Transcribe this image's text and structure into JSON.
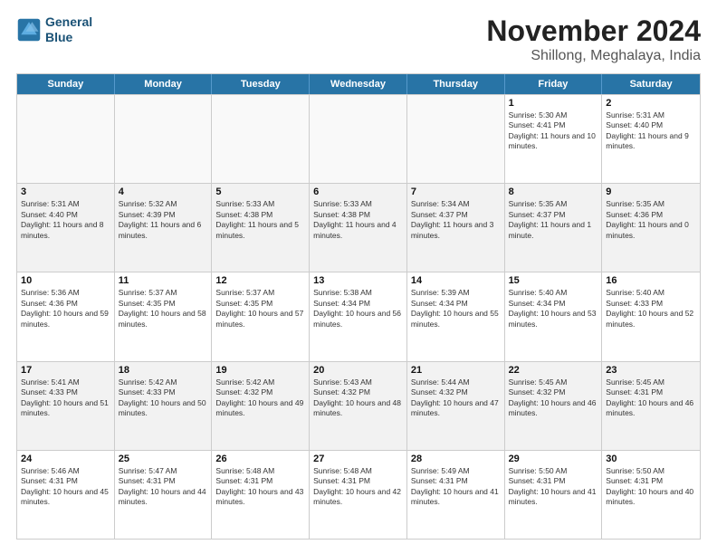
{
  "logo": {
    "line1": "General",
    "line2": "Blue"
  },
  "title": "November 2024",
  "subtitle": "Shillong, Meghalaya, India",
  "days_of_week": [
    "Sunday",
    "Monday",
    "Tuesday",
    "Wednesday",
    "Thursday",
    "Friday",
    "Saturday"
  ],
  "weeks": [
    [
      {
        "day": "",
        "info": "",
        "empty": true
      },
      {
        "day": "",
        "info": "",
        "empty": true
      },
      {
        "day": "",
        "info": "",
        "empty": true
      },
      {
        "day": "",
        "info": "",
        "empty": true
      },
      {
        "day": "",
        "info": "",
        "empty": true
      },
      {
        "day": "1",
        "info": "Sunrise: 5:30 AM\nSunset: 4:41 PM\nDaylight: 11 hours and 10 minutes."
      },
      {
        "day": "2",
        "info": "Sunrise: 5:31 AM\nSunset: 4:40 PM\nDaylight: 11 hours and 9 minutes."
      }
    ],
    [
      {
        "day": "3",
        "info": "Sunrise: 5:31 AM\nSunset: 4:40 PM\nDaylight: 11 hours and 8 minutes."
      },
      {
        "day": "4",
        "info": "Sunrise: 5:32 AM\nSunset: 4:39 PM\nDaylight: 11 hours and 6 minutes."
      },
      {
        "day": "5",
        "info": "Sunrise: 5:33 AM\nSunset: 4:38 PM\nDaylight: 11 hours and 5 minutes."
      },
      {
        "day": "6",
        "info": "Sunrise: 5:33 AM\nSunset: 4:38 PM\nDaylight: 11 hours and 4 minutes."
      },
      {
        "day": "7",
        "info": "Sunrise: 5:34 AM\nSunset: 4:37 PM\nDaylight: 11 hours and 3 minutes."
      },
      {
        "day": "8",
        "info": "Sunrise: 5:35 AM\nSunset: 4:37 PM\nDaylight: 11 hours and 1 minute."
      },
      {
        "day": "9",
        "info": "Sunrise: 5:35 AM\nSunset: 4:36 PM\nDaylight: 11 hours and 0 minutes."
      }
    ],
    [
      {
        "day": "10",
        "info": "Sunrise: 5:36 AM\nSunset: 4:36 PM\nDaylight: 10 hours and 59 minutes."
      },
      {
        "day": "11",
        "info": "Sunrise: 5:37 AM\nSunset: 4:35 PM\nDaylight: 10 hours and 58 minutes."
      },
      {
        "day": "12",
        "info": "Sunrise: 5:37 AM\nSunset: 4:35 PM\nDaylight: 10 hours and 57 minutes."
      },
      {
        "day": "13",
        "info": "Sunrise: 5:38 AM\nSunset: 4:34 PM\nDaylight: 10 hours and 56 minutes."
      },
      {
        "day": "14",
        "info": "Sunrise: 5:39 AM\nSunset: 4:34 PM\nDaylight: 10 hours and 55 minutes."
      },
      {
        "day": "15",
        "info": "Sunrise: 5:40 AM\nSunset: 4:34 PM\nDaylight: 10 hours and 53 minutes."
      },
      {
        "day": "16",
        "info": "Sunrise: 5:40 AM\nSunset: 4:33 PM\nDaylight: 10 hours and 52 minutes."
      }
    ],
    [
      {
        "day": "17",
        "info": "Sunrise: 5:41 AM\nSunset: 4:33 PM\nDaylight: 10 hours and 51 minutes."
      },
      {
        "day": "18",
        "info": "Sunrise: 5:42 AM\nSunset: 4:33 PM\nDaylight: 10 hours and 50 minutes."
      },
      {
        "day": "19",
        "info": "Sunrise: 5:42 AM\nSunset: 4:32 PM\nDaylight: 10 hours and 49 minutes."
      },
      {
        "day": "20",
        "info": "Sunrise: 5:43 AM\nSunset: 4:32 PM\nDaylight: 10 hours and 48 minutes."
      },
      {
        "day": "21",
        "info": "Sunrise: 5:44 AM\nSunset: 4:32 PM\nDaylight: 10 hours and 47 minutes."
      },
      {
        "day": "22",
        "info": "Sunrise: 5:45 AM\nSunset: 4:32 PM\nDaylight: 10 hours and 46 minutes."
      },
      {
        "day": "23",
        "info": "Sunrise: 5:45 AM\nSunset: 4:31 PM\nDaylight: 10 hours and 46 minutes."
      }
    ],
    [
      {
        "day": "24",
        "info": "Sunrise: 5:46 AM\nSunset: 4:31 PM\nDaylight: 10 hours and 45 minutes."
      },
      {
        "day": "25",
        "info": "Sunrise: 5:47 AM\nSunset: 4:31 PM\nDaylight: 10 hours and 44 minutes."
      },
      {
        "day": "26",
        "info": "Sunrise: 5:48 AM\nSunset: 4:31 PM\nDaylight: 10 hours and 43 minutes."
      },
      {
        "day": "27",
        "info": "Sunrise: 5:48 AM\nSunset: 4:31 PM\nDaylight: 10 hours and 42 minutes."
      },
      {
        "day": "28",
        "info": "Sunrise: 5:49 AM\nSunset: 4:31 PM\nDaylight: 10 hours and 41 minutes."
      },
      {
        "day": "29",
        "info": "Sunrise: 5:50 AM\nSunset: 4:31 PM\nDaylight: 10 hours and 41 minutes."
      },
      {
        "day": "30",
        "info": "Sunrise: 5:50 AM\nSunset: 4:31 PM\nDaylight: 10 hours and 40 minutes."
      }
    ]
  ]
}
